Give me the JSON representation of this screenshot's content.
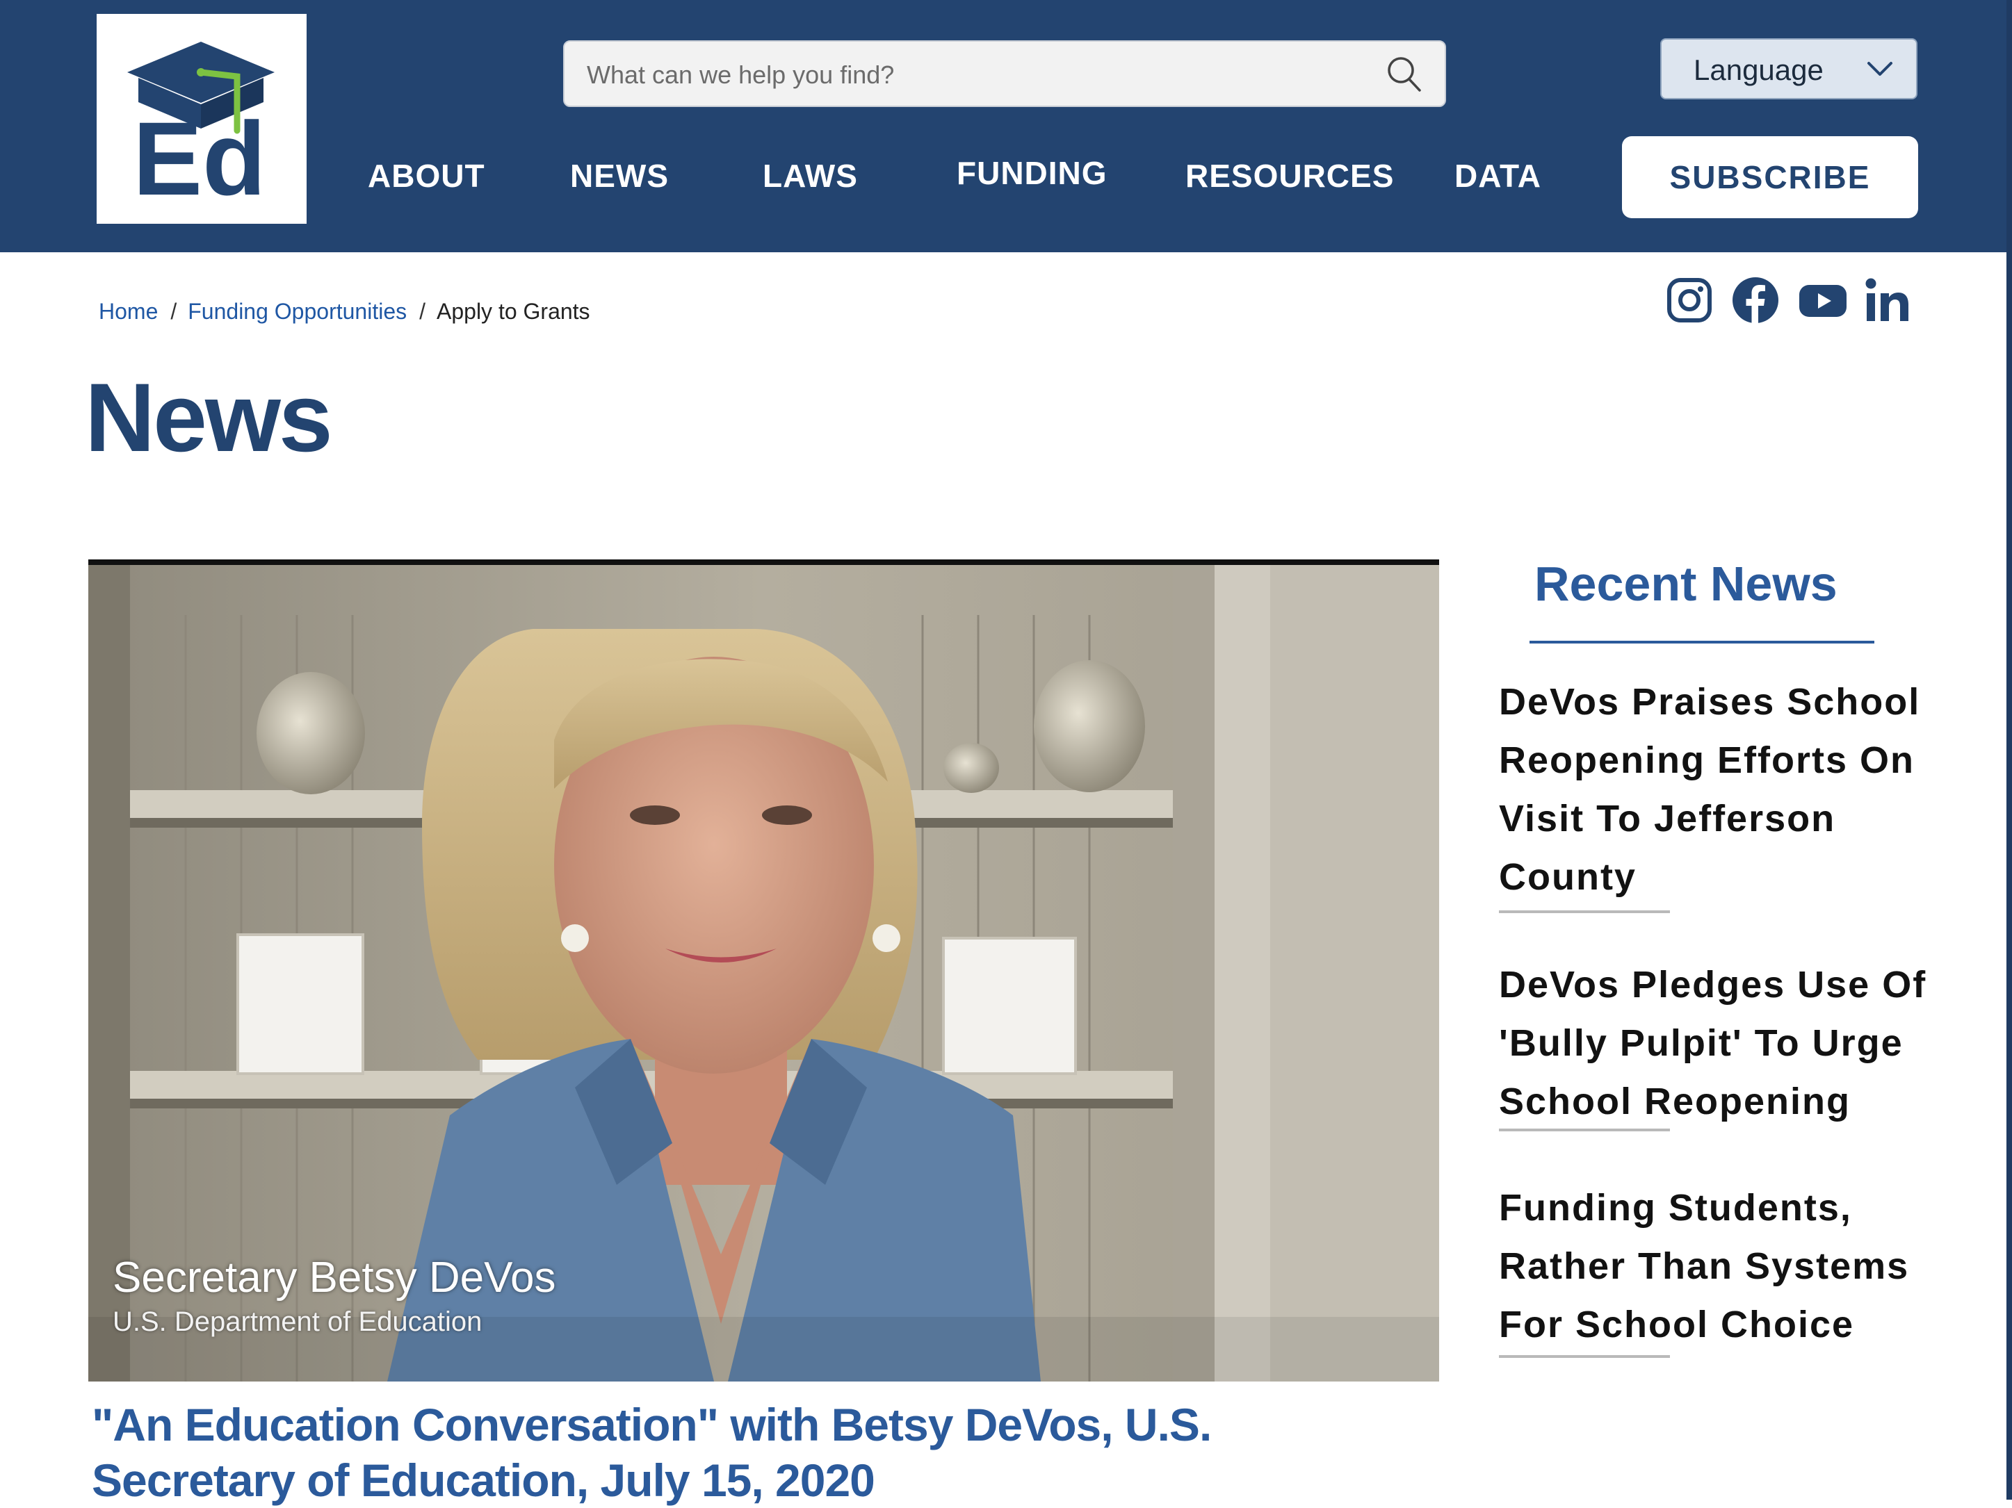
{
  "header": {
    "logo_text": "Ed",
    "search_placeholder": "What can we help you find?",
    "language_label": "Language",
    "nav": [
      "ABOUT",
      "NEWS",
      "LAWS",
      "FUNDING",
      "RESOURCES",
      "DATA"
    ],
    "subscribe_label": "SUBSCRIBE"
  },
  "breadcrumb": {
    "items": [
      "Home",
      "Funding Opportunities"
    ],
    "current": "Apply to Grants"
  },
  "social_icons": [
    "instagram-icon",
    "facebook-icon",
    "youtube-icon",
    "linkedin-icon"
  ],
  "page_title": "News",
  "video": {
    "caption_name": "Secretary Betsy DeVos",
    "caption_org": "U.S. Department of Education"
  },
  "article_title": "\"An Education Conversation\" with Betsy DeVos, U.S. Secretary of Education, July 15, 2020",
  "sidebar": {
    "heading": "Recent News",
    "items": [
      "DeVos Praises School Reopening Efforts On Visit To Jefferson County",
      "DeVos Pledges Use Of 'Bully Pulpit' To Urge School Reopening",
      "Funding Students, Rather Than Systems For School Choice"
    ]
  },
  "colors": {
    "header_bg": "#234470",
    "accent_blue": "#2b5a9b",
    "link_blue": "#1f57a4",
    "logo_green": "#7dc242"
  }
}
